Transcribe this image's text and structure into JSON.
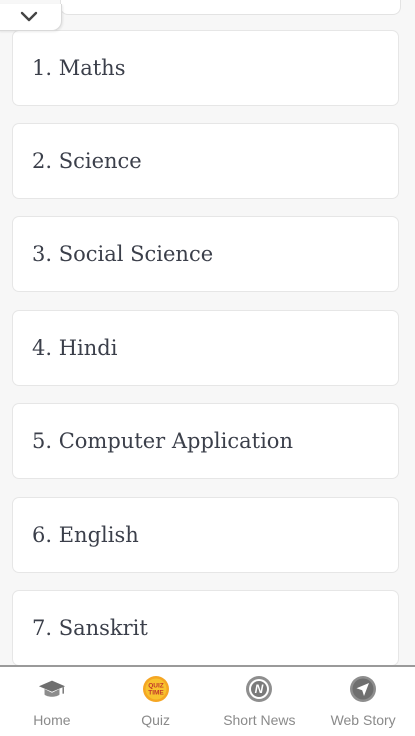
{
  "subjects": [
    {
      "label": "1. Maths"
    },
    {
      "label": "2. Science"
    },
    {
      "label": "3. Social Science"
    },
    {
      "label": "4. Hindi"
    },
    {
      "label": "5. Computer Application"
    },
    {
      "label": "6. English"
    },
    {
      "label": "7. Sanskrit"
    }
  ],
  "bottom_nav": {
    "home": {
      "label": "Home",
      "icon": "graduation-cap-icon"
    },
    "quiz": {
      "label": "Quiz",
      "icon": "quiz-time-icon",
      "icon_text_1": "QUIZ",
      "icon_text_2": "TIME"
    },
    "short_news": {
      "label": "Short News",
      "icon": "news-icon",
      "icon_letter": "N"
    },
    "web_story": {
      "label": "Web Story",
      "icon": "navigation-arrow-icon"
    }
  },
  "colors": {
    "card_text": "#3b3f4a",
    "nav_label": "#8a8a8a",
    "quiz_badge": "#f5a623"
  }
}
